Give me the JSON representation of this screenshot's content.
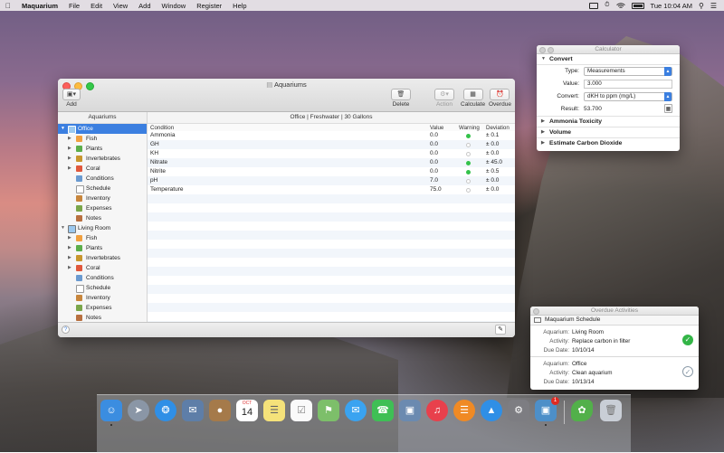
{
  "menubar": {
    "app_name": "Maquarium",
    "items": [
      "File",
      "Edit",
      "View",
      "Add",
      "Window",
      "Register",
      "Help"
    ],
    "clock": "Tue 10:04 AM"
  },
  "main_window": {
    "title": "Aquariums",
    "toolbar": {
      "add_label": "Add",
      "delete_label": "Delete",
      "action_label": "Action",
      "calculate_label": "Calculate",
      "overdue_label": "Overdue"
    },
    "sidebar": {
      "header": "Aquariums",
      "groups": [
        {
          "name": "Office",
          "items": [
            "Fish",
            "Plants",
            "Invertebrates",
            "Coral",
            "Conditions",
            "Schedule",
            "Inventory",
            "Expenses",
            "Notes"
          ]
        },
        {
          "name": "Living Room",
          "items": [
            "Fish",
            "Plants",
            "Invertebrates",
            "Coral",
            "Conditions",
            "Schedule",
            "Inventory",
            "Expenses",
            "Notes"
          ]
        }
      ]
    },
    "content_header": "Office  |  Freshwater  |  30 Gallons",
    "table": {
      "columns": [
        "Condition",
        "Value",
        "Warning",
        "Deviation"
      ],
      "rows": [
        {
          "condition": "Ammonia",
          "value": "0.0",
          "warning": true,
          "deviation": "± 0.1"
        },
        {
          "condition": "GH",
          "value": "0.0",
          "warning": false,
          "deviation": "± 0.0"
        },
        {
          "condition": "KH",
          "value": "0.0",
          "warning": false,
          "deviation": "± 0.0"
        },
        {
          "condition": "Nitrate",
          "value": "0.0",
          "warning": true,
          "deviation": "± 45.0"
        },
        {
          "condition": "Nitrite",
          "value": "0.0",
          "warning": true,
          "deviation": "± 0.5"
        },
        {
          "condition": "pH",
          "value": "7.0",
          "warning": false,
          "deviation": "± 0.0"
        },
        {
          "condition": "Temperature",
          "value": "75.0",
          "warning": false,
          "deviation": "± 0.0"
        }
      ]
    },
    "help_glyph": "?"
  },
  "calculator": {
    "title": "Calculator",
    "sections": [
      "Convert",
      "Ammonia Toxicity",
      "Volume",
      "Estimate Carbon Dioxide"
    ],
    "type_label": "Type:",
    "type_value": "Measurements",
    "value_label": "Value:",
    "value_value": "3.000",
    "convert_label": "Convert:",
    "convert_value": "dKH to ppm (mg/L)",
    "result_label": "Result:",
    "result_value": "53.700"
  },
  "overdue": {
    "title": "Overdue Activities",
    "schedule_title": "Maquarium Schedule",
    "labels": {
      "aquarium": "Aquarium:",
      "activity": "Activity:",
      "due": "Due Date:"
    },
    "cards": [
      {
        "aquarium": "Living Room",
        "activity": "Replace carbon in filter",
        "due": "10/10/14",
        "done": true
      },
      {
        "aquarium": "Office",
        "activity": "Clean aquarium",
        "due": "10/13/14",
        "done": false
      }
    ]
  },
  "dock": {
    "calendar_month": "OCT",
    "calendar_day": "14",
    "badge_count": "1",
    "icons": [
      {
        "name": "finder-icon",
        "color": "#3b8de0"
      },
      {
        "name": "launchpad-icon",
        "color": "#8a96a6"
      },
      {
        "name": "safari-icon",
        "color": "#2f8fe6"
      },
      {
        "name": "mail-stamp-icon",
        "color": "#5e7ea8"
      },
      {
        "name": "contacts-icon",
        "color": "#a57a4a"
      },
      {
        "name": "calendar-icon",
        "color": "#ffffff"
      },
      {
        "name": "notes-icon",
        "color": "#f5e27a"
      },
      {
        "name": "reminders-icon",
        "color": "#fafafa"
      },
      {
        "name": "maps-icon",
        "color": "#7dbf6a"
      },
      {
        "name": "messages-icon",
        "color": "#3aa3f0"
      },
      {
        "name": "facetime-icon",
        "color": "#3fbf55"
      },
      {
        "name": "preview-icon",
        "color": "#6b8ab0"
      },
      {
        "name": "itunes-icon",
        "color": "#e8404c"
      },
      {
        "name": "ibooks-icon",
        "color": "#f08a24"
      },
      {
        "name": "app-store-icon",
        "color": "#2f8fe6"
      },
      {
        "name": "system-preferences-icon",
        "color": "#7d7d82"
      },
      {
        "name": "maquarium-icon",
        "color": "#4d8fc8"
      },
      {
        "name": "leaf-icon",
        "color": "#52b04a"
      },
      {
        "name": "trash-icon",
        "color": "#c9ced6"
      }
    ]
  }
}
